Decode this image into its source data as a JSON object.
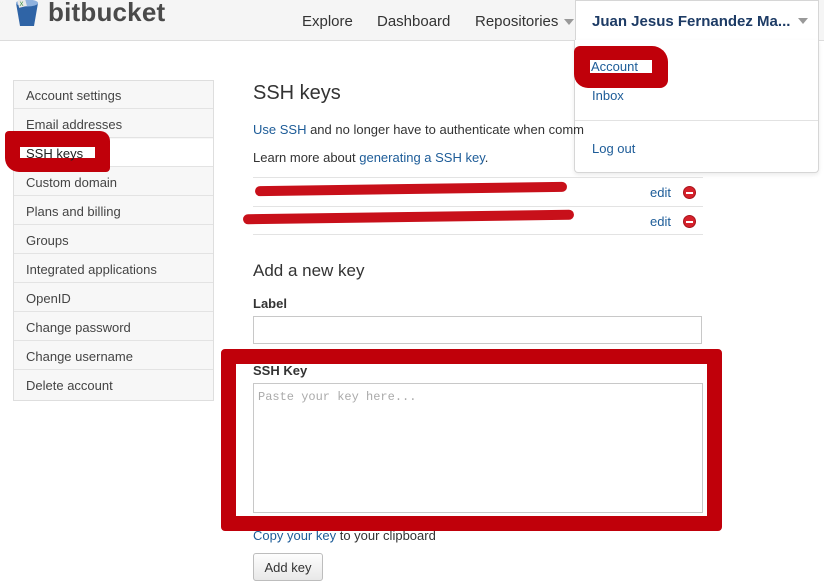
{
  "header": {
    "logo_text": "bitbucket",
    "logo_icon": "bucket-icon",
    "nav": [
      "Explore",
      "Dashboard",
      "Repositories"
    ],
    "user_name": "Juan Jesus Fernandez Ma..."
  },
  "user_menu": {
    "items": [
      "Account",
      "Inbox",
      "Log out"
    ]
  },
  "sidebar": {
    "items": [
      "Account settings",
      "Email addresses",
      "SSH keys",
      "Custom domain",
      "Plans and billing",
      "Groups",
      "Integrated applications",
      "OpenID",
      "Change password",
      "Change username",
      "Delete account"
    ],
    "active": "SSH keys"
  },
  "main": {
    "title": "SSH keys",
    "intro_link": "Use SSH",
    "intro_rest": " and no longer have to authenticate when comm",
    "learn_prefix": "Learn more about ",
    "learn_link": "generating a SSH key",
    "learn_suffix": ".",
    "keys": [
      {
        "edit": "edit",
        "icon": "delete-icon"
      },
      {
        "edit": "edit",
        "icon": "delete-icon"
      }
    ],
    "add_title": "Add a new key",
    "label_label": "Label",
    "label_value": "",
    "sshkey_label": "SSH Key",
    "sshkey_placeholder": "Paste your key here...",
    "copy_link": "Copy your key",
    "copy_rest": " to your clipboard",
    "add_button": "Add key"
  },
  "colors": {
    "link": "#1d5c98",
    "annotation": "#c0000a",
    "delete": "#d6212b"
  }
}
